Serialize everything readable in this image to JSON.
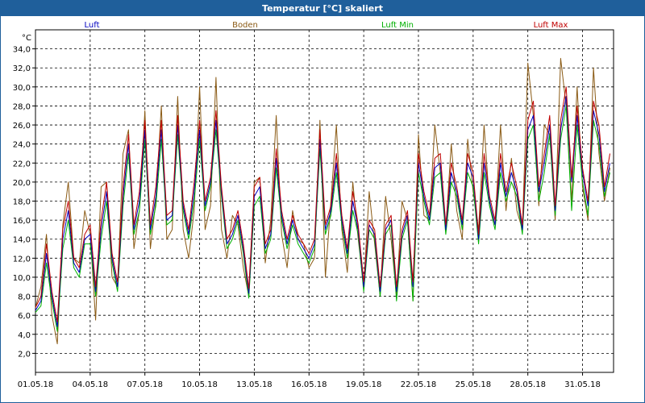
{
  "window": {
    "title": "Temperatur [°C] skaliert"
  },
  "chart_data": {
    "type": "line",
    "title": "Temperatur [°C] skaliert",
    "ylabel": "°C",
    "xlabel": "",
    "ylim": [
      0,
      36
    ],
    "xlim": [
      0,
      31.7
    ],
    "grid": true,
    "legend_position": "top",
    "yticks": [
      "2,0",
      "4,0",
      "6,0",
      "8,0",
      "10,0",
      "12,0",
      "14,0",
      "16,0",
      "18,0",
      "20,0",
      "22,0",
      "24,0",
      "26,0",
      "28,0",
      "30,0",
      "32,0",
      "34,0"
    ],
    "xticks": [
      "01.05.18",
      "04.05.18",
      "07.05.18",
      "10.05.18",
      "13.05.18",
      "16.05.18",
      "19.05.18",
      "22.05.18",
      "25.05.18",
      "28.05.18",
      "31.05.18"
    ],
    "x_days": [
      0,
      0.3,
      0.6,
      0.9,
      1.2,
      1.5,
      1.8,
      2.1,
      2.4,
      2.7,
      3.0,
      3.3,
      3.6,
      3.9,
      4.2,
      4.5,
      4.8,
      5.1,
      5.4,
      5.7,
      6.0,
      6.3,
      6.6,
      6.9,
      7.2,
      7.5,
      7.8,
      8.1,
      8.4,
      8.7,
      9.0,
      9.3,
      9.6,
      9.9,
      10.2,
      10.5,
      10.8,
      11.1,
      11.4,
      11.7,
      12.0,
      12.3,
      12.6,
      12.9,
      13.2,
      13.5,
      13.8,
      14.1,
      14.4,
      14.7,
      15.0,
      15.3,
      15.6,
      15.9,
      16.2,
      16.5,
      16.8,
      17.1,
      17.4,
      17.7,
      18.0,
      18.3,
      18.6,
      18.9,
      19.2,
      19.5,
      19.8,
      20.1,
      20.4,
      20.7,
      21.0,
      21.3,
      21.6,
      21.9,
      22.2,
      22.5,
      22.8,
      23.1,
      23.4,
      23.7,
      24.0,
      24.3,
      24.6,
      24.9,
      25.2,
      25.5,
      25.8,
      26.1,
      26.4,
      26.7,
      27.0,
      27.3,
      27.6,
      27.9,
      28.2,
      28.5,
      28.8,
      29.1,
      29.4,
      29.7,
      30.0,
      30.3,
      30.6,
      30.9,
      31.2,
      31.5
    ],
    "series": [
      {
        "name": "Luft",
        "color": "#0000c0",
        "values": [
          6.5,
          7.5,
          12.5,
          8.0,
          4.8,
          14.0,
          17.0,
          11.5,
          10.5,
          14.0,
          14.5,
          8.5,
          15.0,
          19.0,
          12.0,
          9.0,
          18.5,
          24.0,
          15.0,
          18.0,
          25.5,
          15.0,
          18.5,
          25.5,
          16.0,
          16.5,
          26.0,
          17.5,
          14.5,
          19.0,
          25.5,
          17.5,
          20.0,
          26.5,
          19.0,
          13.5,
          14.5,
          16.5,
          13.0,
          8.3,
          18.5,
          19.5,
          13.0,
          14.5,
          22.5,
          16.5,
          13.5,
          16.0,
          14.0,
          13.0,
          12.0,
          13.5,
          24.5,
          15.0,
          17.0,
          22.0,
          16.0,
          12.5,
          18.0,
          15.0,
          9.0,
          15.5,
          14.5,
          8.5,
          15.0,
          16.0,
          8.5,
          14.5,
          16.5,
          9.0,
          22.0,
          18.5,
          16.0,
          21.5,
          22.0,
          15.0,
          21.0,
          19.0,
          15.5,
          22.0,
          20.5,
          14.0,
          22.0,
          18.0,
          15.5,
          22.0,
          18.5,
          21.0,
          19.0,
          15.0,
          25.5,
          27.0,
          19.0,
          22.0,
          26.0,
          17.0,
          25.5,
          29.0,
          20.0,
          27.0,
          21.0,
          17.5,
          27.5,
          25.0,
          19.0,
          22.0
        ]
      },
      {
        "name": "Boden",
        "color": "#8a5a14",
        "values": [
          6.8,
          9.0,
          14.5,
          6.0,
          3.0,
          15.5,
          20.0,
          12.0,
          11.5,
          17.0,
          14.5,
          5.5,
          19.5,
          20.0,
          10.0,
          9.0,
          23.0,
          25.5,
          13.0,
          17.0,
          27.5,
          13.0,
          18.0,
          28.0,
          14.0,
          15.0,
          29.0,
          15.0,
          12.0,
          17.0,
          30.0,
          15.0,
          17.5,
          31.0,
          15.0,
          12.0,
          16.5,
          15.5,
          11.0,
          8.0,
          20.0,
          20.5,
          11.5,
          16.0,
          27.0,
          14.5,
          11.0,
          17.0,
          14.0,
          13.5,
          11.0,
          12.0,
          26.5,
          10.0,
          18.0,
          26.0,
          15.0,
          10.5,
          20.0,
          14.0,
          9.0,
          19.0,
          13.5,
          8.0,
          18.5,
          14.0,
          8.0,
          18.0,
          16.0,
          7.5,
          25.0,
          16.5,
          16.0,
          26.0,
          21.0,
          15.0,
          24.0,
          17.0,
          14.0,
          24.5,
          19.0,
          15.0,
          26.0,
          17.5,
          15.5,
          26.0,
          17.0,
          22.5,
          17.0,
          15.0,
          32.5,
          27.0,
          17.5,
          26.0,
          25.0,
          16.0,
          33.0,
          28.0,
          18.0,
          30.0,
          19.5,
          16.0,
          32.0,
          23.0,
          18.0,
          21.5
        ]
      },
      {
        "name": "Luft Min",
        "color": "#00b000",
        "values": [
          6.3,
          7.0,
          11.5,
          7.5,
          4.3,
          13.0,
          16.0,
          11.0,
          10.0,
          13.5,
          13.5,
          8.0,
          14.0,
          18.0,
          11.5,
          8.5,
          17.5,
          23.0,
          14.5,
          17.0,
          24.5,
          14.5,
          17.5,
          24.5,
          15.5,
          16.0,
          25.0,
          17.0,
          14.0,
          18.0,
          24.5,
          17.0,
          19.5,
          25.5,
          18.5,
          13.0,
          14.0,
          16.0,
          12.5,
          7.8,
          17.5,
          18.5,
          12.5,
          14.0,
          21.5,
          16.0,
          13.0,
          15.5,
          13.5,
          12.5,
          11.5,
          13.0,
          23.5,
          14.5,
          16.5,
          21.0,
          15.5,
          12.0,
          17.0,
          14.5,
          8.5,
          15.0,
          14.0,
          8.0,
          14.5,
          15.5,
          7.5,
          14.0,
          16.0,
          7.5,
          21.0,
          18.0,
          15.5,
          20.5,
          21.0,
          14.5,
          20.0,
          18.5,
          15.0,
          21.0,
          19.5,
          13.5,
          21.0,
          17.5,
          15.0,
          21.0,
          18.0,
          20.0,
          18.5,
          14.5,
          24.5,
          26.0,
          18.0,
          21.0,
          25.0,
          16.5,
          24.5,
          28.0,
          17.0,
          26.0,
          20.0,
          16.5,
          26.5,
          24.0,
          18.5,
          21.0
        ]
      },
      {
        "name": "Luft Max",
        "color": "#c00000",
        "values": [
          6.8,
          8.0,
          13.5,
          8.5,
          5.3,
          15.0,
          18.0,
          12.0,
          11.0,
          14.5,
          15.5,
          9.0,
          16.0,
          20.0,
          12.5,
          9.5,
          19.5,
          25.0,
          15.5,
          19.0,
          26.5,
          15.5,
          19.5,
          26.5,
          16.5,
          17.0,
          27.0,
          18.0,
          15.0,
          20.0,
          26.5,
          18.0,
          20.5,
          27.5,
          19.5,
          14.0,
          15.0,
          17.0,
          13.5,
          8.8,
          19.5,
          20.5,
          13.5,
          15.0,
          23.5,
          17.0,
          14.0,
          16.5,
          14.5,
          13.5,
          12.5,
          14.0,
          25.5,
          15.5,
          17.5,
          23.0,
          16.5,
          13.0,
          19.0,
          15.5,
          9.5,
          16.0,
          15.0,
          9.0,
          15.5,
          16.5,
          9.0,
          15.0,
          17.0,
          9.5,
          23.0,
          19.0,
          16.5,
          22.5,
          23.0,
          15.5,
          22.0,
          19.5,
          16.0,
          23.0,
          21.0,
          14.5,
          23.0,
          18.5,
          16.0,
          23.0,
          19.0,
          22.0,
          19.5,
          15.5,
          26.5,
          28.5,
          19.5,
          23.0,
          27.0,
          17.5,
          26.5,
          30.0,
          20.5,
          28.0,
          21.5,
          18.0,
          28.5,
          26.0,
          19.5,
          23.0
        ]
      }
    ]
  }
}
